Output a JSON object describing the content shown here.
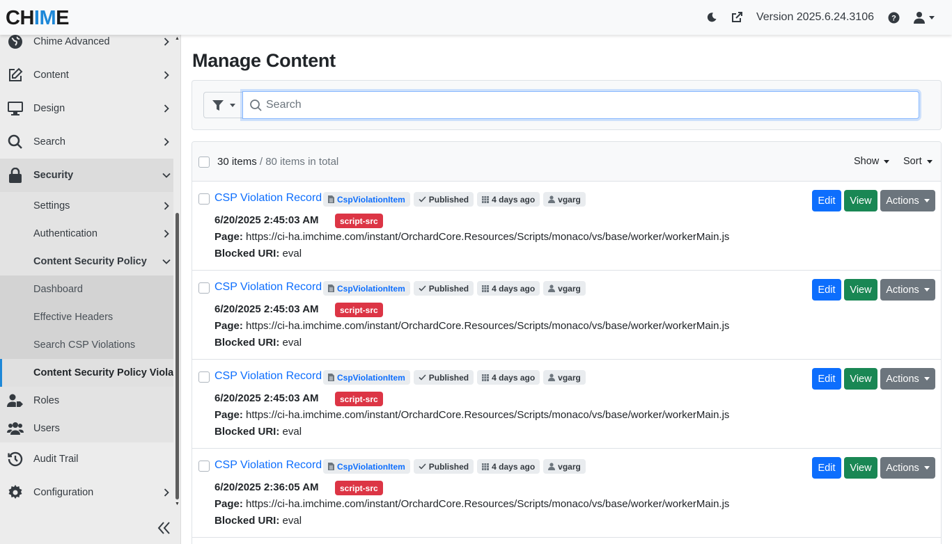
{
  "header": {
    "logo_pre": "CH",
    "logo_hl": "IM",
    "logo_post": "E",
    "version": "Version 2025.6.24.3106",
    "icons": [
      "moon-icon",
      "external-link-icon",
      "help-icon",
      "user-icon"
    ]
  },
  "sidebar": {
    "items": [
      {
        "label": "Chime Advanced",
        "icon": "globe-icon"
      },
      {
        "label": "Content",
        "icon": "edit-icon"
      },
      {
        "label": "Design",
        "icon": "monitor-icon"
      },
      {
        "label": "Search",
        "icon": "search-icon"
      },
      {
        "label": "Security",
        "icon": "lock-icon"
      },
      {
        "label": "Roles",
        "icon": "user-tag-icon"
      },
      {
        "label": "Users",
        "icon": "users-icon"
      },
      {
        "label": "Audit Trail",
        "icon": "history-icon"
      },
      {
        "label": "Configuration",
        "icon": "gear-icon"
      }
    ],
    "security_sub": [
      "Settings",
      "Authentication",
      "Content Security Policy"
    ],
    "csp_sub": [
      "Dashboard",
      "Effective Headers",
      "Search CSP Violations",
      "Content Security Policy Violations"
    ]
  },
  "main": {
    "title": "Manage Content",
    "search_placeholder": "Search",
    "items_count": "30 items",
    "items_total": " / 80 items in total",
    "show_label": "Show",
    "sort_label": "Sort",
    "rows": [
      {
        "title": "CSP Violation Record",
        "type": "CspViolationItem",
        "status": "Published",
        "age": "4 days ago",
        "user": "vgarg",
        "date": "6/20/2025 2:45:03 AM",
        "directive": "script-src",
        "page_label": "Page:",
        "page": "https://ci-ha.imchime.com/instant/OrchardCore.Resources/Scripts/monaco/vs/base/worker/workerMain.js",
        "blocked_label": "Blocked URI:",
        "blocked": "eval"
      },
      {
        "title": "CSP Violation Record",
        "type": "CspViolationItem",
        "status": "Published",
        "age": "4 days ago",
        "user": "vgarg",
        "date": "6/20/2025 2:45:03 AM",
        "directive": "script-src",
        "page_label": "Page:",
        "page": "https://ci-ha.imchime.com/instant/OrchardCore.Resources/Scripts/monaco/vs/base/worker/workerMain.js",
        "blocked_label": "Blocked URI:",
        "blocked": "eval"
      },
      {
        "title": "CSP Violation Record",
        "type": "CspViolationItem",
        "status": "Published",
        "age": "4 days ago",
        "user": "vgarg",
        "date": "6/20/2025 2:45:03 AM",
        "directive": "script-src",
        "page_label": "Page:",
        "page": "https://ci-ha.imchime.com/instant/OrchardCore.Resources/Scripts/monaco/vs/base/worker/workerMain.js",
        "blocked_label": "Blocked URI:",
        "blocked": "eval"
      },
      {
        "title": "CSP Violation Record",
        "type": "CspViolationItem",
        "status": "Published",
        "age": "4 days ago",
        "user": "vgarg",
        "date": "6/20/2025 2:36:05 AM",
        "directive": "script-src",
        "page_label": "Page:",
        "page": "https://ci-ha.imchime.com/instant/OrchardCore.Resources/Scripts/monaco/vs/base/worker/workerMain.js",
        "blocked_label": "Blocked URI:",
        "blocked": "eval"
      }
    ],
    "buttons": {
      "edit": "Edit",
      "view": "View",
      "actions": "Actions"
    }
  },
  "colors": {
    "primary": "#0d6efd",
    "success": "#198754",
    "secondary": "#6c757d",
    "danger": "#dc3545",
    "logo_accent": "#1e88d8"
  }
}
